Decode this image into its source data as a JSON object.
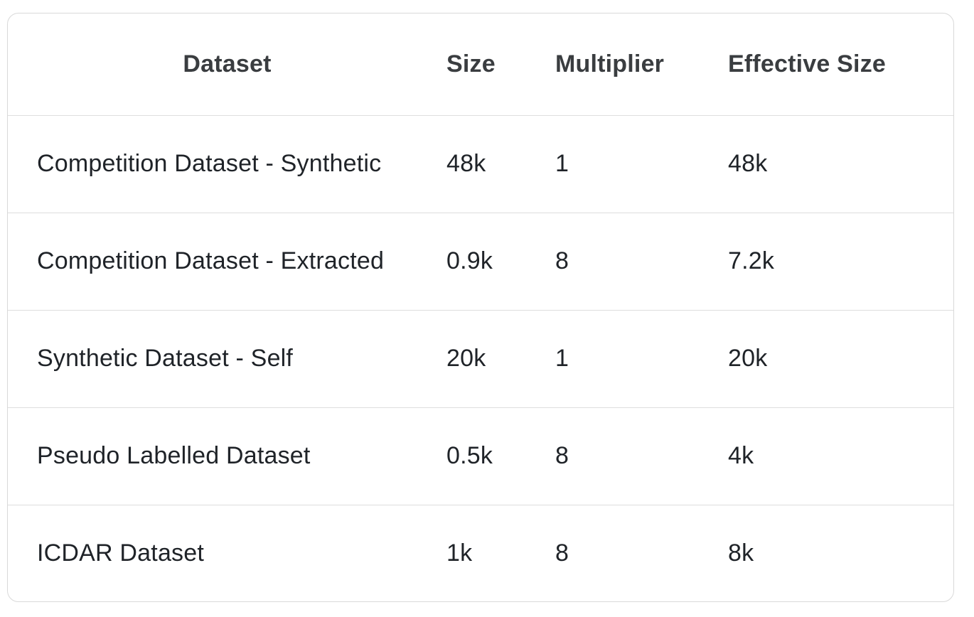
{
  "table": {
    "headers": {
      "dataset": "Dataset",
      "size": "Size",
      "multiplier": "Multiplier",
      "effective_size": "Effective Size"
    },
    "rows": [
      {
        "dataset": "Competition Dataset - Synthetic",
        "size": "48k",
        "multiplier": "1",
        "effective_size": "48k"
      },
      {
        "dataset": "Competition Dataset - Extracted",
        "size": "0.9k",
        "multiplier": "8",
        "effective_size": "7.2k"
      },
      {
        "dataset": "Synthetic Dataset - Self",
        "size": "20k",
        "multiplier": "1",
        "effective_size": "20k"
      },
      {
        "dataset": "Pseudo Labelled Dataset",
        "size": "0.5k",
        "multiplier": "8",
        "effective_size": "4k"
      },
      {
        "dataset": "ICDAR Dataset",
        "size": "1k",
        "multiplier": "8",
        "effective_size": "8k"
      }
    ]
  }
}
